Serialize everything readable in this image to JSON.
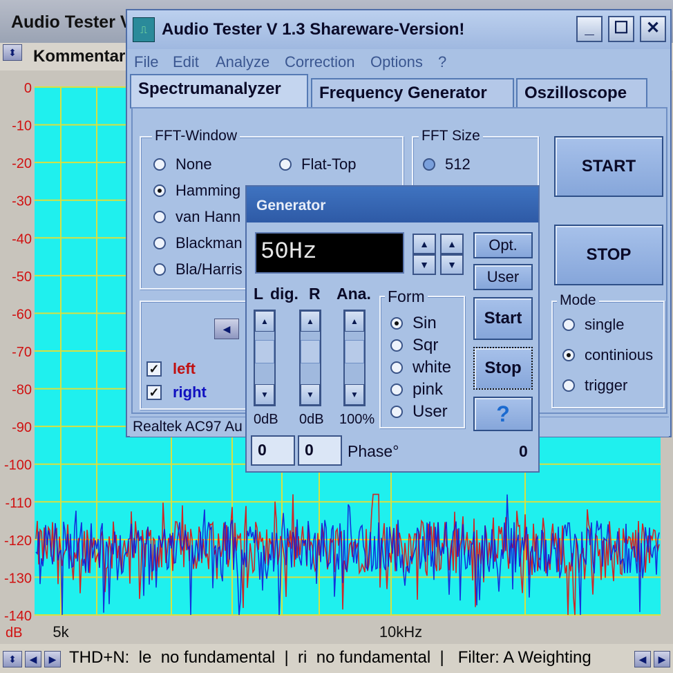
{
  "background_window": {
    "title": "Audio Tester V",
    "toolbar_label": "Kommentar"
  },
  "chart_data": {
    "type": "line",
    "xlabel": "",
    "ylabel": "dB",
    "x_ticks": [
      "5k",
      "10kHz"
    ],
    "y_ticks": [
      "0",
      "-10",
      "-20",
      "-30",
      "-40",
      "-50",
      "-60",
      "-70",
      "-80",
      "-90",
      "-100",
      "-110",
      "-120",
      "-130",
      "-140"
    ],
    "ylim": [
      -140,
      0
    ],
    "grid": true,
    "series": [
      {
        "color": "#e01010"
      },
      {
        "color": "#1010d8"
      }
    ],
    "noise_floor_range": [
      -140,
      -108
    ],
    "peak_at": "10kHz"
  },
  "status_bar": {
    "text": "THD+N:  le  no fundamental  |  ri  no fundamental  |   Filter: A Weighting"
  },
  "main_window": {
    "title": "Audio Tester V 1.3 Shareware-Version!",
    "menu": [
      "File",
      "Edit",
      "Analyze",
      "Correction",
      "Options",
      "?"
    ],
    "tabs": [
      "Spectrumanalyzer",
      "Frequency Generator",
      "Oszilloscope"
    ],
    "fft_window": {
      "legend": "FFT-Window",
      "options": [
        {
          "label": "None",
          "selected": false
        },
        {
          "label": "Hamming",
          "selected": true
        },
        {
          "label": "van Hann",
          "selected": false
        },
        {
          "label": "Blackman",
          "selected": false
        },
        {
          "label": "Bla/Harris",
          "selected": false
        },
        {
          "label": "Flat-Top",
          "selected": false
        }
      ]
    },
    "fft_size": {
      "legend": "FFT Size",
      "value": "512"
    },
    "start_label": "START",
    "stop_label": "STOP",
    "mode": {
      "legend": "Mode",
      "options": [
        {
          "label": "single",
          "selected": false
        },
        {
          "label": "continious",
          "selected": true
        },
        {
          "label": "trigger",
          "selected": false
        }
      ]
    },
    "channels": {
      "left": "left",
      "right": "right",
      "left_color": "#d01010",
      "right_color": "#1010c0"
    },
    "device": "Realtek AC97 Au"
  },
  "generator": {
    "title": "Generator",
    "frequency": "50Hz",
    "opt_label": "Opt.",
    "user_label": "User",
    "start_label": "Start",
    "stop_label": "Stop",
    "help_label": "?",
    "headers": {
      "l": "L",
      "dig": "dig.",
      "r": "R",
      "ana": "Ana."
    },
    "slider_values": [
      "0dB",
      "0dB",
      "100%"
    ],
    "form": {
      "legend": "Form",
      "options": [
        {
          "label": "Sin",
          "selected": true
        },
        {
          "label": "Sqr",
          "selected": false
        },
        {
          "label": "white",
          "selected": false
        },
        {
          "label": "pink",
          "selected": false
        },
        {
          "label": "User",
          "selected": false
        }
      ]
    },
    "field1": "0",
    "field2": "0",
    "phase_label": "Phase°",
    "phase_value": "0"
  }
}
